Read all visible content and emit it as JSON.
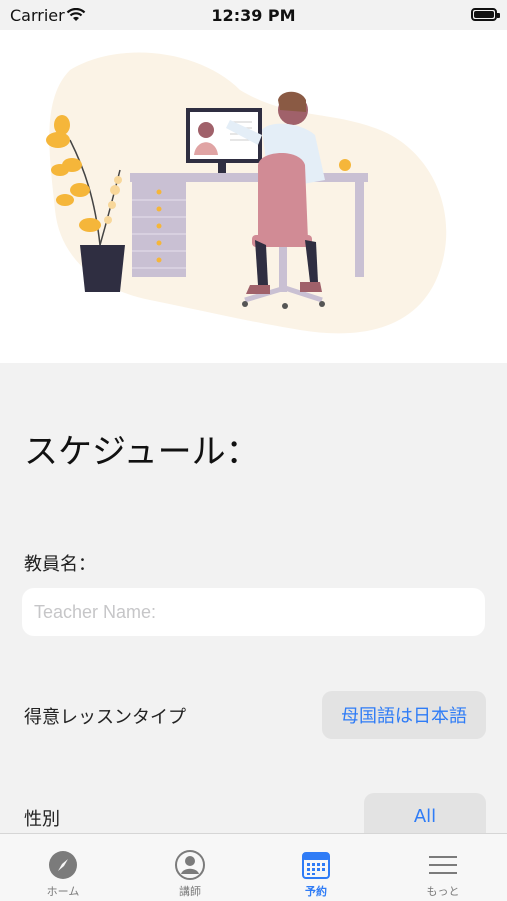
{
  "status_bar": {
    "carrier": "Carrier",
    "time": "12:39 PM"
  },
  "schedule": {
    "title": "スケジュール：",
    "teacher_name_label": "教員名：",
    "teacher_name_placeholder": "Teacher Name:",
    "teacher_name_value": "",
    "lesson_type_label": "得意レッスンタイプ",
    "lesson_type_value": "母国語は日本語",
    "gender_label": "性別",
    "gender_value": "All"
  },
  "tabbar": {
    "tabs": [
      {
        "label": "ホーム",
        "icon": "compass-icon",
        "active": false
      },
      {
        "label": "講師",
        "icon": "person-icon",
        "active": false
      },
      {
        "label": "予約",
        "icon": "calendar-icon",
        "active": true
      },
      {
        "label": "もっと",
        "icon": "menu-icon",
        "active": false
      }
    ]
  },
  "colors": {
    "accent": "#2f7cf6",
    "background": "#f2f2f2"
  }
}
